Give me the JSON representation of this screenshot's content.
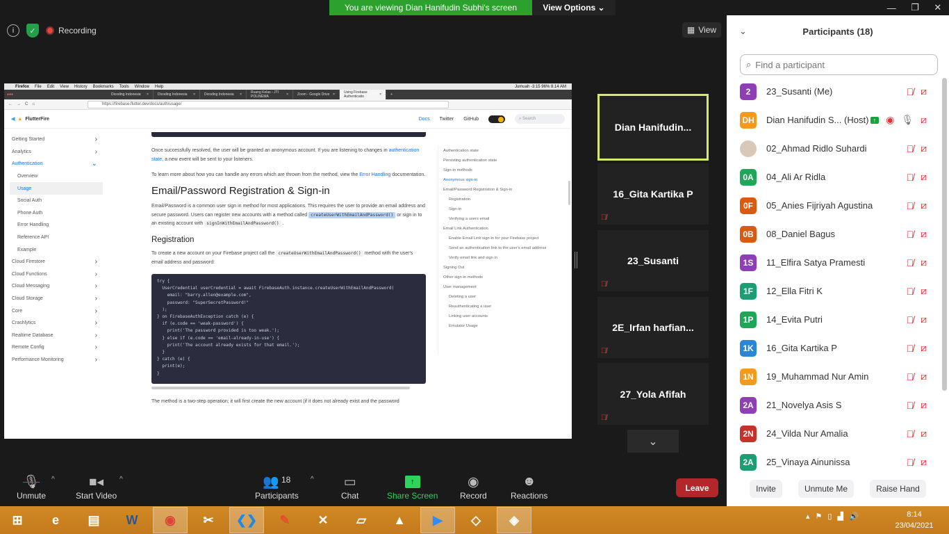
{
  "banner": {
    "text": "You are viewing Dian Hanifudin Subhi's screen",
    "view_options": "View Options"
  },
  "top": {
    "recording": "Recording",
    "view": "View"
  },
  "shared": {
    "menubar": [
      "Firefox",
      "File",
      "Edit",
      "View",
      "History",
      "Bookmarks",
      "Tools",
      "Window",
      "Help"
    ],
    "status": "Jumuah -3:15   96%   8.14 AM",
    "tabs": [
      "Dicoding Indonesia",
      "Dicoding Indonesia",
      "Dicoding Indonesia",
      "Ruang Kelas - JTI POLINEMA",
      "Zoom - Google Drive",
      "Using Firebase Authenticatio"
    ],
    "url": "https://firebase.flutter.dev/docs/auth/usage/",
    "site": {
      "logo": "FlutterFire",
      "nav": [
        "Docs",
        "Twitter",
        "GitHub"
      ],
      "search": "Search"
    },
    "sidebar": [
      {
        "label": "Getting Started",
        "chev": "›"
      },
      {
        "label": "Analytics",
        "chev": "›"
      },
      {
        "label": "Authentication",
        "chev": "⌄",
        "open": true
      },
      {
        "label": "Overview",
        "sub": true
      },
      {
        "label": "Usage",
        "sub": true,
        "active": true
      },
      {
        "label": "Social Auth",
        "sub": true
      },
      {
        "label": "Phone Auth",
        "sub": true
      },
      {
        "label": "Error Handling",
        "sub": true
      },
      {
        "label": "Reference API",
        "sub": true
      },
      {
        "label": "Example",
        "sub": true
      },
      {
        "label": "Cloud Firestore",
        "chev": "›"
      },
      {
        "label": "Cloud Functions",
        "chev": "›"
      },
      {
        "label": "Cloud Messaging",
        "chev": "›"
      },
      {
        "label": "Cloud Storage",
        "chev": "›"
      },
      {
        "label": "Core",
        "chev": "›"
      },
      {
        "label": "Crashlytics",
        "chev": "›"
      },
      {
        "label": "Realtime Database",
        "chev": "›"
      },
      {
        "label": "Remote Config",
        "chev": "›"
      },
      {
        "label": "Performance Monitoring",
        "chev": "›"
      }
    ],
    "content": {
      "p1a": "Once successfully resolved, the user will be granted an anonymous account. If you are listening to changes in ",
      "p1link": "authentication state",
      "p1b": ", a new event will be sent to your listeners.",
      "p2a": "To learn more about how you can handle any errors which are thrown from the method, view the ",
      "p2link": "Error Handling",
      "p2b": " documentation.",
      "h2": "Email/Password Registration & Sign-in",
      "p3a": "Email/Password is a common user sign in method for most applications. This requires the user to provide an email address and secure password. Users can register new accounts with a method called ",
      "p3code1": "createUserWithEmailAndPassword()",
      "p3b": " or sign in to an existing account with ",
      "p3code2": "signInWithEmailAndPassword()",
      "p3c": " .",
      "h3": "Registration",
      "p4a": "To create a new account on your Firebase project call the ",
      "p4code": "createUserWithEmailAndPassword()",
      "p4b": " method with the user's email address and password:",
      "code": "try {\n  UserCredential userCredential = await FirebaseAuth.instance.createUserWithEmailAndPassword(\n    email: \"barry.allen@example.com\",\n    password: \"SuperSecretPassword!\"\n  );\n} on FirebaseAuthException catch (e) {\n  if (e.code == 'weak-password') {\n    print('The password provided is too weak.');\n  } else if (e.code == 'email-already-in-use') {\n    print('The account already exists for that email.');\n  }\n} catch (e) {\n  print(e);\n}",
      "p5": "The method is a two-step operation; it will first create the new account (if it does not already exist and the password"
    },
    "toc": [
      {
        "label": "Authentication state"
      },
      {
        "label": "Persisting authentication state"
      },
      {
        "label": "Sign-in methods"
      },
      {
        "label": "Anonymous sign-in",
        "active": true
      },
      {
        "label": "Email/Password Registration & Sign-in"
      },
      {
        "label": "Registration",
        "l2": true
      },
      {
        "label": "Sign-in",
        "l2": true
      },
      {
        "label": "Verifying a users email",
        "l2": true
      },
      {
        "label": "Email Link Authentication"
      },
      {
        "label": "Enable Email Link sign-in for your Firebase project",
        "l2": true
      },
      {
        "label": "Send an authentication link to the user's email address",
        "l2": true
      },
      {
        "label": "Verify email link and sign in",
        "l2": true
      },
      {
        "label": "Signing Out"
      },
      {
        "label": "Other sign-in methods"
      },
      {
        "label": "User management"
      },
      {
        "label": "Deleting a user",
        "l2": true
      },
      {
        "label": "Reauthenticating a user",
        "l2": true
      },
      {
        "label": "Linking user accounts",
        "l2": true
      },
      {
        "label": "Emulator Usage",
        "l2": true
      }
    ]
  },
  "thumbnails": [
    {
      "name": "Dian  Hanifudin...",
      "active": true
    },
    {
      "name": "16_Gita Kartika P",
      "muted": true
    },
    {
      "name": "23_Susanti",
      "muted": true
    },
    {
      "name": "2E_Irfan  harfian...",
      "muted": true
    },
    {
      "name": "27_Yola Afifah",
      "muted": true
    }
  ],
  "panel": {
    "title": "Participants (18)",
    "search_placeholder": "Find a participant",
    "participants": [
      {
        "initials": "2",
        "color": "#8e3fb4",
        "name": "23_Susanti (Me)"
      },
      {
        "initials": "DH",
        "color": "#f39a1e",
        "name": "Dian Hanifudin S...  (Host)",
        "host": true
      },
      {
        "initials": "",
        "color": "#d9c7b8",
        "name": "02_Ahmad Ridlo Suhardi",
        "photo": true
      },
      {
        "initials": "0A",
        "color": "#1fa658",
        "name": "04_Ali Ar Ridla"
      },
      {
        "initials": "0F",
        "color": "#db5a12",
        "name": "05_Anies Fijriyah Agustina"
      },
      {
        "initials": "0B",
        "color": "#db5a12",
        "name": "08_Daniel Bagus"
      },
      {
        "initials": "1S",
        "color": "#8e3fb4",
        "name": "11_Elfira Satya Pramesti"
      },
      {
        "initials": "1F",
        "color": "#1c9e74",
        "name": "12_Ella Fitri K"
      },
      {
        "initials": "1P",
        "color": "#1fa658",
        "name": "14_Evita Putri"
      },
      {
        "initials": "1K",
        "color": "#2b86d6",
        "name": "16_Gita Kartika P"
      },
      {
        "initials": "1N",
        "color": "#f39a1e",
        "name": "19_Muhammad Nur Amin"
      },
      {
        "initials": "2A",
        "color": "#8e3fb4",
        "name": "21_Novelya Asis S"
      },
      {
        "initials": "2N",
        "color": "#c5312b",
        "name": "24_Vilda Nur Amalia"
      },
      {
        "initials": "2A",
        "color": "#1c9e74",
        "name": "25_Vinaya Ainunissa"
      }
    ],
    "buttons": [
      "Invite",
      "Unmute Me",
      "Raise Hand"
    ]
  },
  "toolbar": {
    "unmute": "Unmute",
    "start_video": "Start Video",
    "participants": "Participants",
    "participants_count": "18",
    "chat": "Chat",
    "share_screen": "Share Screen",
    "record": "Record",
    "reactions": "Reactions",
    "leave": "Leave"
  },
  "taskbar": {
    "icons": [
      "windows-start",
      "internet-explorer",
      "file-explorer",
      "word",
      "chrome",
      "snipping-tool",
      "vscode",
      "pdf-reader",
      "xampp",
      "notes",
      "android-studio",
      "zoom",
      "unity",
      "app"
    ],
    "active": [
      "chrome",
      "vscode",
      "zoom",
      "app"
    ],
    "time": "8:14",
    "date": "23/04/2021"
  }
}
